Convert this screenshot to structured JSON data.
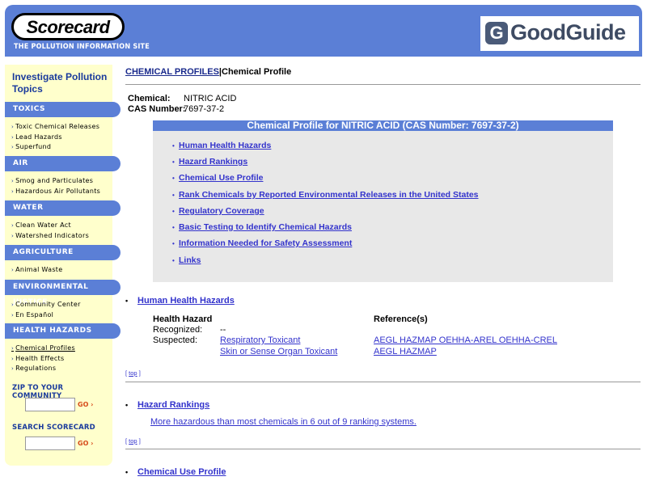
{
  "header": {
    "logo": "Scorecard",
    "tagline": "THE POLLUTION INFORMATION SITE",
    "partner_icon": "G",
    "partner": "GoodGuide"
  },
  "sidebar": {
    "title": "Investigate Pollution Topics",
    "sections": [
      {
        "label": "TOXICS",
        "links": [
          "Toxic Chemical Releases",
          "Lead Hazards",
          "Superfund"
        ]
      },
      {
        "label": "AIR",
        "links": [
          "Smog and Particulates",
          "Hazardous Air Pollutants"
        ]
      },
      {
        "label": "WATER",
        "links": [
          "Clean Water Act",
          "Watershed Indicators"
        ]
      },
      {
        "label": "AGRICULTURE",
        "links": [
          "Animal Waste"
        ]
      },
      {
        "label": "ENVIRONMENTAL JUSTICE",
        "links": [
          "Community Center",
          "En Español"
        ]
      },
      {
        "label": "HEALTH HAZARDS",
        "links": [
          "Chemical Profiles",
          "Health Effects",
          "Regulations"
        ]
      }
    ],
    "zip_label": "ZIP TO YOUR COMMUNITY",
    "zip_go": "GO",
    "search_label": "SEARCH SCORECARD",
    "search_go": "GO",
    "arrow_glyph": "›"
  },
  "breadcrumb": {
    "link": "CHEMICAL PROFILES",
    "separator": "|",
    "current": "Chemical Profile"
  },
  "chemical": {
    "chemical_label": "Chemical:",
    "chemical_value": "NITRIC ACID",
    "cas_label": "CAS Number:",
    "cas_value": "7697-37-2"
  },
  "profile_box": {
    "heading": "Chemical Profile for NITRIC ACID (CAS Number: 7697-37-2)",
    "links": [
      "Human Health Hazards",
      "Hazard Rankings",
      "Chemical Use Profile",
      "Rank Chemicals by Reported Environmental Releases in the United States",
      "Regulatory Coverage",
      "Basic Testing to Identify Chemical Hazards",
      "Information Needed for Safety Assessment",
      "Links"
    ]
  },
  "human_health": {
    "title": "Human Health Hazards",
    "col_hazard": "Health Hazard",
    "col_refs": "Reference(s)",
    "recognized_label": "Recognized:",
    "recognized_value": "--",
    "suspected_label": "Suspected:",
    "suspected_1": "Respiratory Toxicant",
    "suspected_2": "Skin or Sense Organ Toxicant",
    "refs_1": "AEGL HAZMAP OEHHA-AREL OEHHA-CREL",
    "refs_2": "AEGL HAZMAP"
  },
  "hazard_rankings": {
    "title": "Hazard Rankings",
    "summary": "More hazardous than most chemicals in 6 out of 9 ranking systems."
  },
  "chemical_use": {
    "title": "Chemical Use Profile"
  },
  "top_link": {
    "open": "[ ",
    "label": "top",
    "close": " ]"
  },
  "bullet": "•",
  "colors": {
    "header_blue": "#5b7fd6",
    "sidebar_yellow": "#ffffcc",
    "link_blue": "#3333cc",
    "box_gray": "#e8e8e8"
  }
}
